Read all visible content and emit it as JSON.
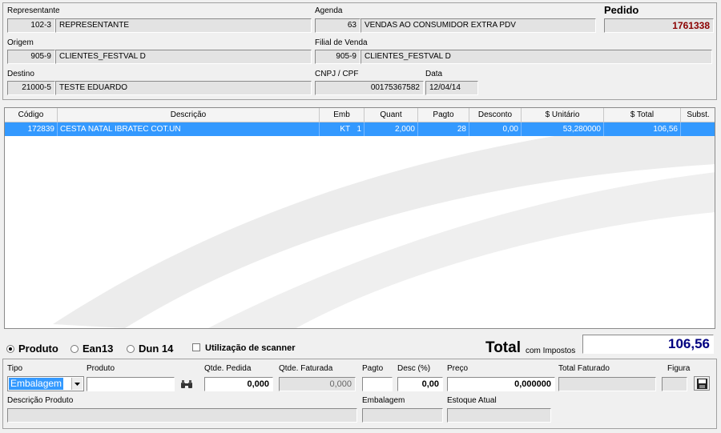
{
  "header": {
    "representante": {
      "label": "Representante",
      "code": "102-3",
      "name": "REPRESENTANTE"
    },
    "agenda": {
      "label": "Agenda",
      "code": "63",
      "name": "VENDAS AO CONSUMIDOR EXTRA PDV"
    },
    "pedido": {
      "label": "Pedido",
      "value": "1761338"
    },
    "origem": {
      "label": "Origem",
      "code": "905-9",
      "name": "CLIENTES_FESTVAL D"
    },
    "filial": {
      "label": "Filial de Venda",
      "code": "905-9",
      "name": "CLIENTES_FESTVAL D"
    },
    "destino": {
      "label": "Destino",
      "code": "21000-5",
      "name": "TESTE EDUARDO"
    },
    "cnpj": {
      "label": "CNPJ / CPF",
      "value": "00175367582"
    },
    "data": {
      "label": "Data",
      "value": "12/04/14"
    }
  },
  "grid": {
    "columns": [
      "Código",
      "Descrição",
      "Emb",
      "Quant",
      "Pagto",
      "Desconto",
      "$ Unitário",
      "$ Total",
      "Subst."
    ],
    "rows": [
      {
        "codigo": "172839",
        "descricao": "CESTA NATAL IBRATEC COT.UN",
        "emb": "KT",
        "emb_qty": "1",
        "quant": "2,000",
        "pagto": "28",
        "desconto": "0,00",
        "unitario": "53,280000",
        "total": "106,56",
        "subst": ""
      }
    ]
  },
  "search_mode": {
    "options": [
      "Produto",
      "Ean13",
      "Dun 14"
    ],
    "selected": "Produto",
    "scanner_label": "Utilização de scanner"
  },
  "total": {
    "label": "Total",
    "sublabel": "com Impostos",
    "value": "106,56"
  },
  "entry": {
    "tipo_label": "Tipo",
    "tipo_value": "Embalagem",
    "produto_label": "Produto",
    "produto_value": "",
    "qtde_pedida_label": "Qtde. Pedida",
    "qtde_pedida_value": "0,000",
    "qtde_faturada_label": "Qtde. Faturada",
    "qtde_faturada_value": "0,000",
    "pagto_label": "Pagto",
    "pagto_value": "",
    "desc_label": "Desc (%)",
    "desc_value": "0,00",
    "preco_label": "Preço",
    "preco_value": "0,000000",
    "total_faturado_label": "Total Faturado",
    "total_faturado_value": "",
    "figura_label": "Figura",
    "descricao_label": "Descrição Produto",
    "descricao_value": "",
    "embalagem_label": "Embalagem",
    "embalagem_value": "",
    "estoque_label": "Estoque Atual",
    "estoque_value": ""
  },
  "colors": {
    "selection": "#3399ff",
    "pedido": "#8b0000",
    "total": "#000080"
  },
  "icons": [
    "binoculars-icon",
    "save-icon",
    "dropdown-arrow-icon"
  ]
}
